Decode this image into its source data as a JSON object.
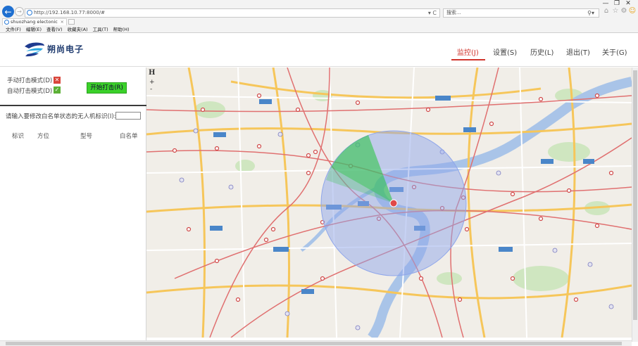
{
  "browser": {
    "url": "http://192.168.10.77:8000/#",
    "search_placeholder": "搜索...",
    "tab_title": "shuozhang electonic",
    "menu": [
      "文件(F)",
      "编辑(E)",
      "查看(V)",
      "收藏夹(A)",
      "工具(T)",
      "帮助(H)"
    ]
  },
  "app": {
    "brand_name": "朔尚电子",
    "nav": [
      {
        "label": "监控(J)",
        "active": true
      },
      {
        "label": "设置(S)",
        "active": false
      },
      {
        "label": "历史(L)",
        "active": false
      },
      {
        "label": "退出(T)",
        "active": false
      },
      {
        "label": "关于(G)",
        "active": false
      }
    ],
    "accent_color": "#d0342c"
  },
  "left_panel": {
    "manual_mode_label": "手动打击模式(D)",
    "manual_mode_checked": false,
    "auto_mode_label": "自动打击模式(D)",
    "auto_mode_checked": true,
    "start_button_label": "开始打击(R)",
    "whitelist_prompt": "请输入要修改白名单状态的无人机标识(I):",
    "whitelist_input_value": "",
    "table_columns": [
      "标识",
      "方位",
      "型号",
      "白名单"
    ]
  },
  "map": {
    "tool_pan_label": "H",
    "zoom_in": "+",
    "zoom_out": "-",
    "detection_zone_color": "#8fa6ea",
    "sector_color": "#22c43a",
    "target_color": "#e04848"
  }
}
